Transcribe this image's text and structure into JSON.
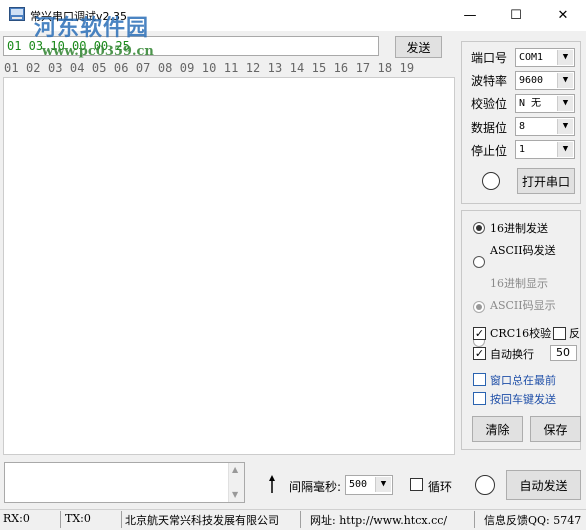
{
  "window": {
    "title": "常兴串口调试v2.35",
    "minimize_glyph": "—",
    "maximize_glyph": "☐",
    "close_glyph": "✕"
  },
  "watermark": {
    "name": "河东软件园",
    "url": "www.pc0359.cn"
  },
  "send": {
    "input_value": "01 03 10 00 00 25",
    "button_label": "发送"
  },
  "ruler": "01 02 03 04 05 06 07 08 09 10 11 12 13 14 15 16 17 18 19",
  "serial": {
    "port_label": "端口号",
    "port_value": "COM1",
    "baud_label": "波特率",
    "baud_value": "9600",
    "parity_label": "校验位",
    "parity_value": "N 无",
    "databits_label": "数据位",
    "databits_value": "8",
    "stopbits_label": "停止位",
    "stopbits_value": "1",
    "open_button": "打开串口"
  },
  "options": {
    "hex_send": "16进制发送",
    "ascii_send": "ASCII码发送",
    "hex_display": "16进制显示",
    "ascii_display": "ASCII码显示",
    "crc16": "CRC16校验",
    "reverse": "反",
    "auto_wrap": "自动换行",
    "wrap_value": "50",
    "always_top": "窗口总在最前",
    "enter_send": "按回车键发送",
    "clear_button": "清除",
    "save_button": "保存"
  },
  "bottom": {
    "interval_label": "间隔毫秒:",
    "interval_value": "500",
    "loop_label": "循环",
    "auto_send_button": "自动发送"
  },
  "status": {
    "rx": "RX:0",
    "tx": "TX:0",
    "company": "北京航天常兴科技发展有限公司",
    "website": "网址: http://www.htcx.cc/",
    "feedback": "信息反馈QQ: 5747"
  },
  "colors": {
    "hex_text": "#1a8a1a",
    "watermark_blue": "#2b6fb8",
    "accent_blue": "#1f4fa8"
  }
}
